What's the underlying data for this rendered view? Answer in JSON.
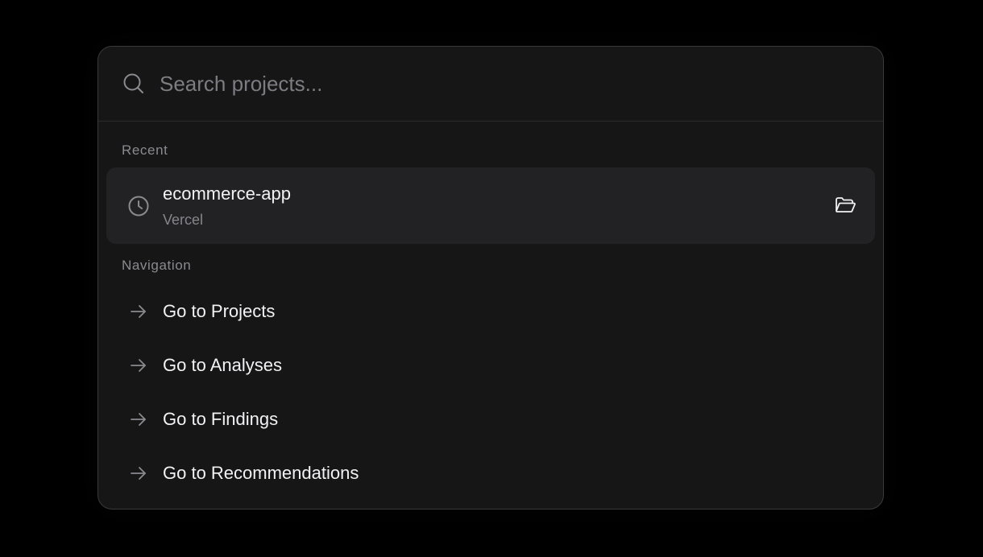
{
  "search": {
    "placeholder": "Search projects...",
    "icon": "search-icon"
  },
  "recent": {
    "label": "Recent",
    "items": [
      {
        "title": "ecommerce-app",
        "subtitle": "Vercel",
        "icon": "clock-icon",
        "action_icon": "folder-open-icon"
      }
    ]
  },
  "navigation": {
    "label": "Navigation",
    "items": [
      {
        "label": "Go to Projects",
        "icon": "arrow-right-icon"
      },
      {
        "label": "Go to Analyses",
        "icon": "arrow-right-icon"
      },
      {
        "label": "Go to Findings",
        "icon": "arrow-right-icon"
      },
      {
        "label": "Go to Recommendations",
        "icon": "arrow-right-icon"
      }
    ]
  },
  "colors": {
    "background": "#000000",
    "panel": "#161617",
    "highlight": "#222225",
    "text_primary": "#f2f2f4",
    "text_muted": "#85858b"
  }
}
